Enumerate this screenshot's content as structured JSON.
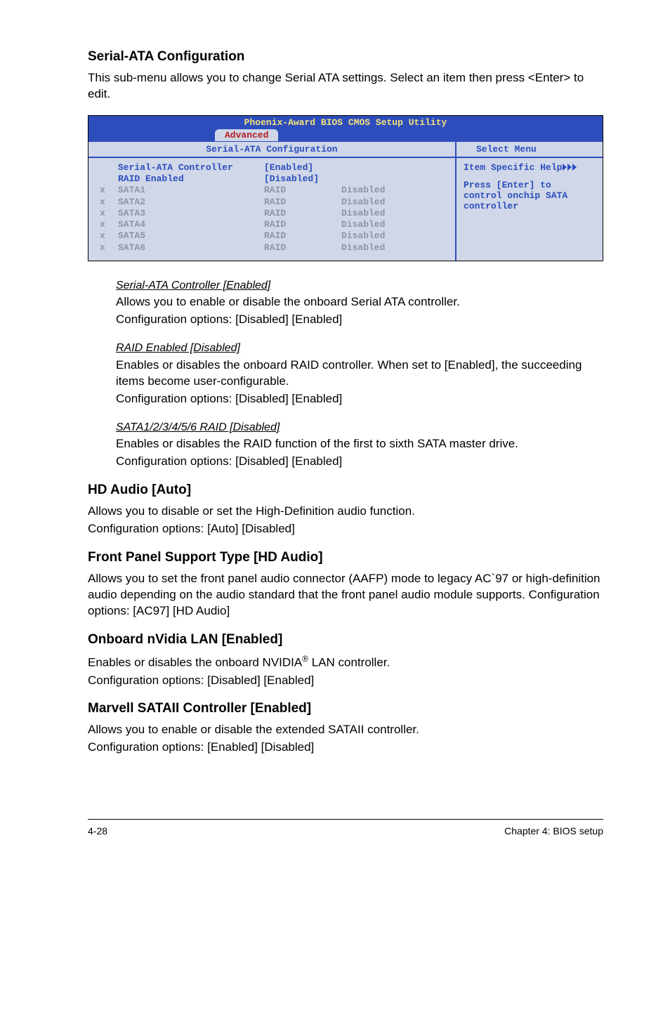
{
  "sec1": {
    "heading": "Serial-ATA Configuration",
    "intro": "This sub-menu allows you to change Serial ATA settings. Select an item then press <Enter> to edit."
  },
  "bios": {
    "title": "Phoenix-Award BIOS CMOS Setup Utility",
    "tab": "Advanced",
    "subhdr_left": "Serial-ATA Configuration",
    "subhdr_right": "Select Menu",
    "help_title": "Item Specific Help",
    "help_body1": "Press [Enter] to",
    "help_body2": "control onchip SATA",
    "help_body3": "controller",
    "row_ctrl_label": "Serial-ATA Controller",
    "row_ctrl_val": "[Enabled]",
    "row_raid_label": "RAID Enabled",
    "row_raid_val": "[Disabled]",
    "x": "x",
    "raid": "RAID",
    "disabled": "Disabled",
    "sata1": "SATA1",
    "sata2": "SATA2",
    "sata3": "SATA3",
    "sata4": "SATA4",
    "sata5": "SATA5",
    "sata6": "SATA6"
  },
  "sub1": {
    "head": "Serial-ATA Controller [Enabled]",
    "p1": "Allows you to enable or disable the onboard Serial ATA controller.",
    "p2": "Configuration options: [Disabled] [Enabled]"
  },
  "sub2": {
    "head": "RAID Enabled [Disabled]",
    "p1": "Enables or disables the onboard RAID controller. When set to [Enabled], the succeeding items become user-configurable.",
    "p2": "Configuration options: [Disabled] [Enabled]"
  },
  "sub3": {
    "head": "SATA1/2/3/4/5/6  RAID [Disabled]",
    "p1": "Enables or disables the RAID function of the first to sixth SATA master drive.",
    "p2": "Configuration options: [Disabled] [Enabled]"
  },
  "sec2": {
    "heading": "HD Audio [Auto]",
    "p1": "Allows you to disable or set the High-Definition audio function.",
    "p2": "Configuration options: [Auto] [Disabled]"
  },
  "sec3": {
    "heading": "Front Panel Support Type [HD Audio]",
    "p1": "Allows you to set the front panel audio connector (AAFP) mode to legacy AC`97 or high-definition audio depending on the audio standard that the front panel audio module supports. Configuration options: [AC97] [HD Audio]"
  },
  "sec4": {
    "heading": "Onboard nVidia LAN [Enabled]",
    "p1_a": "Enables or disables the onboard NVIDIA",
    "p1_b": " LAN controller.",
    "p2": "Configuration options: [Disabled] [Enabled]"
  },
  "sec5": {
    "heading": "Marvell SATAII Controller [Enabled]",
    "p1": "Allows you to enable or disable the extended SATAII controller.",
    "p2": "Configuration options: [Enabled] [Disabled]"
  },
  "footer": {
    "left": "4-28",
    "right": "Chapter 4: BIOS setup"
  },
  "reg": "®"
}
